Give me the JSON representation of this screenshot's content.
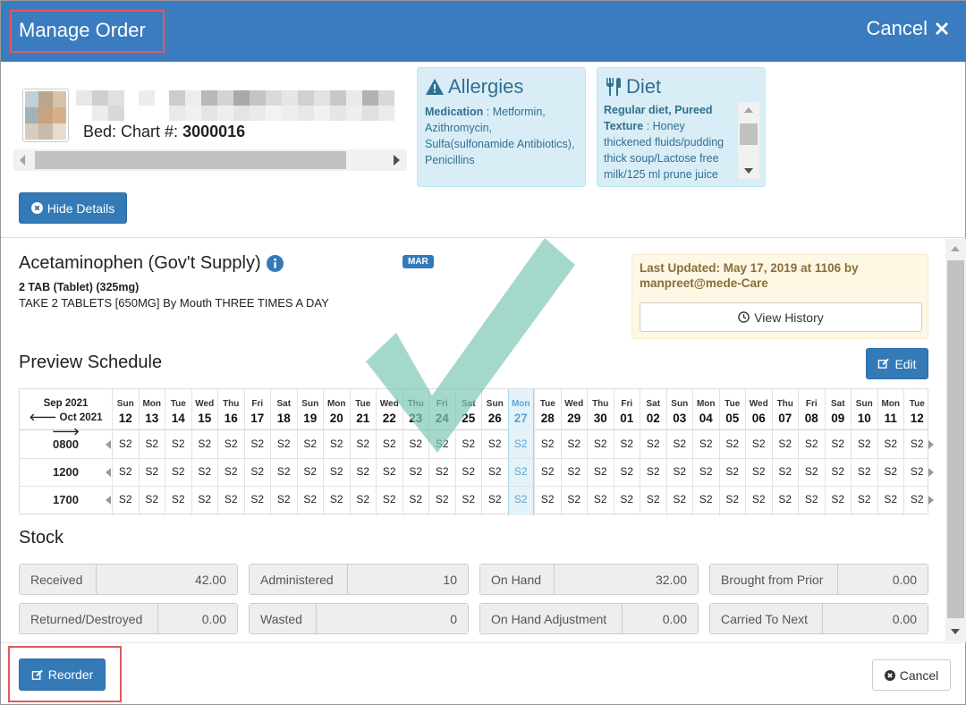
{
  "modal": {
    "title": "Manage Order",
    "cancel_label": "Cancel"
  },
  "patient": {
    "bed_label": "Bed: Chart #:",
    "chart_number": "3000016"
  },
  "allergies": {
    "title": "Allergies",
    "medication_label": "Medication",
    "medication_value": " : Metformin, Azithromycin, Sulfa(sulfonamide Antibiotics), Penicillins"
  },
  "diet": {
    "title": "Diet",
    "bold_text": "Regular diet, Pureed Texture",
    "rest_text": " : Honey thickened fluids/pudding thick soup/Lactose free milk/125 ml prune juice"
  },
  "hide_details_label": "Hide Details",
  "medication": {
    "name": "Acetaminophen (Gov't Supply)",
    "badge": "MAR",
    "dose": "2 TAB (Tablet) (325mg)",
    "instructions": "TAKE 2 TABLETS [650MG] By Mouth THREE TIMES A DAY"
  },
  "last_updated": {
    "text_line1": "Last Updated: May 17, 2019 at 1106 by",
    "text_line2": "manpreet@mede-Care",
    "view_history_label": "View History"
  },
  "schedule": {
    "title": "Preview Schedule",
    "edit_label": "Edit",
    "month_current": "Sep 2021",
    "month_prev": "Oct 2021",
    "times": [
      "0800",
      "1200",
      "1700"
    ],
    "cell_value": "S2",
    "today_index": 15,
    "days": [
      {
        "dow": "Sun",
        "num": "12"
      },
      {
        "dow": "Mon",
        "num": "13"
      },
      {
        "dow": "Tue",
        "num": "14"
      },
      {
        "dow": "Wed",
        "num": "15"
      },
      {
        "dow": "Thu",
        "num": "16"
      },
      {
        "dow": "Fri",
        "num": "17"
      },
      {
        "dow": "Sat",
        "num": "18"
      },
      {
        "dow": "Sun",
        "num": "19"
      },
      {
        "dow": "Mon",
        "num": "20"
      },
      {
        "dow": "Tue",
        "num": "21"
      },
      {
        "dow": "Wed",
        "num": "22"
      },
      {
        "dow": "Thu",
        "num": "23"
      },
      {
        "dow": "Fri",
        "num": "24"
      },
      {
        "dow": "Sat",
        "num": "25"
      },
      {
        "dow": "Sun",
        "num": "26"
      },
      {
        "dow": "Mon",
        "num": "27"
      },
      {
        "dow": "Tue",
        "num": "28"
      },
      {
        "dow": "Wed",
        "num": "29"
      },
      {
        "dow": "Thu",
        "num": "30"
      },
      {
        "dow": "Fri",
        "num": "01"
      },
      {
        "dow": "Sat",
        "num": "02"
      },
      {
        "dow": "Sun",
        "num": "03"
      },
      {
        "dow": "Mon",
        "num": "04"
      },
      {
        "dow": "Tue",
        "num": "05"
      },
      {
        "dow": "Wed",
        "num": "06"
      },
      {
        "dow": "Thu",
        "num": "07"
      },
      {
        "dow": "Fri",
        "num": "08"
      },
      {
        "dow": "Sat",
        "num": "09"
      },
      {
        "dow": "Sun",
        "num": "10"
      },
      {
        "dow": "Mon",
        "num": "11"
      },
      {
        "dow": "Tue",
        "num": "12"
      }
    ]
  },
  "stock": {
    "title": "Stock",
    "received_label": "Received",
    "received_value": "42.00",
    "administered_label": "Administered",
    "administered_value": "10",
    "on_hand_label": "On Hand",
    "on_hand_value": "32.00",
    "brought_label": "Brought from Prior",
    "brought_value": "0.00",
    "returned_label": "Returned/Destroyed",
    "returned_value": "0.00",
    "wasted_label": "Wasted",
    "wasted_value": "0",
    "adjustment_label": "On Hand Adjustment",
    "adjustment_value": "0.00",
    "carried_label": "Carried To Next",
    "carried_value": "0.00"
  },
  "footer": {
    "reorder_label": "Reorder",
    "cancel_label": "Cancel"
  },
  "colors": {
    "header": "#3b7bbf",
    "primary": "#337ab7",
    "info_bg": "#d9edf7",
    "warning_bg": "#fcf8e3",
    "today_highlight": "#e4f2fa",
    "checkmark": "#7ec8b8"
  }
}
